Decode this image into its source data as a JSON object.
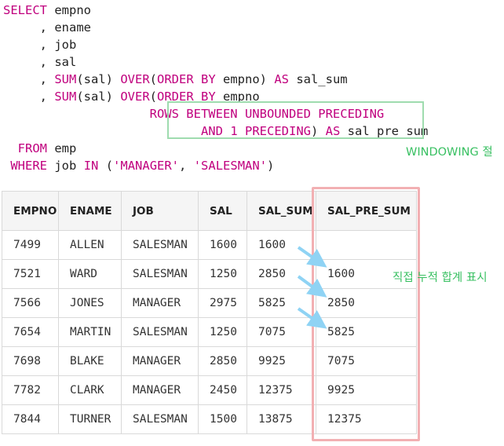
{
  "sql": {
    "lines": [
      {
        "parts": [
          {
            "t": "SELECT",
            "c": "kw"
          },
          {
            "t": " empno",
            "c": "plain"
          }
        ]
      },
      {
        "parts": [
          {
            "t": "     , ename",
            "c": "plain"
          }
        ]
      },
      {
        "parts": [
          {
            "t": "     , job",
            "c": "plain"
          }
        ]
      },
      {
        "parts": [
          {
            "t": "     , sal",
            "c": "plain"
          }
        ]
      },
      {
        "parts": [
          {
            "t": "     , ",
            "c": "plain"
          },
          {
            "t": "SUM",
            "c": "kw"
          },
          {
            "t": "(sal) ",
            "c": "plain"
          },
          {
            "t": "OVER",
            "c": "kw"
          },
          {
            "t": "(",
            "c": "plain"
          },
          {
            "t": "ORDER BY",
            "c": "kw"
          },
          {
            "t": " empno) ",
            "c": "plain"
          },
          {
            "t": "AS",
            "c": "kw"
          },
          {
            "t": " sal_sum",
            "c": "plain"
          }
        ]
      },
      {
        "parts": [
          {
            "t": "     , ",
            "c": "plain"
          },
          {
            "t": "SUM",
            "c": "kw"
          },
          {
            "t": "(sal) ",
            "c": "plain"
          },
          {
            "t": "OVER",
            "c": "kw"
          },
          {
            "t": "(",
            "c": "plain"
          },
          {
            "t": "ORDER BY",
            "c": "kw"
          },
          {
            "t": " empno",
            "c": "plain"
          }
        ]
      },
      {
        "parts": [
          {
            "t": "                    ",
            "c": "plain"
          },
          {
            "t": "ROWS BETWEEN UNBOUNDED PRECEDING",
            "c": "kw"
          }
        ]
      },
      {
        "parts": [
          {
            "t": "                           ",
            "c": "plain"
          },
          {
            "t": "AND",
            "c": "kw"
          },
          {
            "t": " ",
            "c": "plain"
          },
          {
            "t": "1",
            "c": "kw"
          },
          {
            "t": " ",
            "c": "plain"
          },
          {
            "t": "PRECEDING",
            "c": "kw"
          },
          {
            "t": ") ",
            "c": "plain"
          },
          {
            "t": "AS",
            "c": "kw"
          },
          {
            "t": " sal_pre_sum",
            "c": "plain"
          }
        ]
      },
      {
        "parts": []
      },
      {
        "parts": [
          {
            "t": "  ",
            "c": "plain"
          },
          {
            "t": "FROM",
            "c": "kw"
          },
          {
            "t": " emp",
            "c": "plain"
          }
        ]
      },
      {
        "parts": [
          {
            "t": " ",
            "c": "plain"
          },
          {
            "t": "WHERE",
            "c": "kw"
          },
          {
            "t": " job ",
            "c": "plain"
          },
          {
            "t": "IN",
            "c": "kw"
          },
          {
            "t": " (",
            "c": "plain"
          },
          {
            "t": "'MANAGER'",
            "c": "str"
          },
          {
            "t": ", ",
            "c": "plain"
          },
          {
            "t": "'SALESMAN'",
            "c": "str"
          },
          {
            "t": ")",
            "c": "plain"
          }
        ]
      }
    ]
  },
  "window_label": "WINDOWING 절",
  "note": "직접 누적 합계 표시",
  "table": {
    "columns": [
      "EMPNO",
      "ENAME",
      "JOB",
      "SAL",
      "SAL_SUM",
      "SAL_PRE_SUM"
    ],
    "rows": [
      [
        "7499",
        "ALLEN",
        "SALESMAN",
        "1600",
        "1600",
        ""
      ],
      [
        "7521",
        "WARD",
        "SALESMAN",
        "1250",
        "2850",
        "1600"
      ],
      [
        "7566",
        "JONES",
        "MANAGER",
        "2975",
        "5825",
        "2850"
      ],
      [
        "7654",
        "MARTIN",
        "SALESMAN",
        "1250",
        "7075",
        "5825"
      ],
      [
        "7698",
        "BLAKE",
        "MANAGER",
        "2850",
        "9925",
        "7075"
      ],
      [
        "7782",
        "CLARK",
        "MANAGER",
        "2450",
        "12375",
        "9925"
      ],
      [
        "7844",
        "TURNER",
        "SALESMAN",
        "1500",
        "13875",
        "12375"
      ]
    ]
  },
  "colors": {
    "keyword": "#c0007e",
    "window_box": "#9fdcaf",
    "annotation_text": "#39c062",
    "highlight_box": "#f2b0b3",
    "arrow": "#8fd3f4"
  }
}
